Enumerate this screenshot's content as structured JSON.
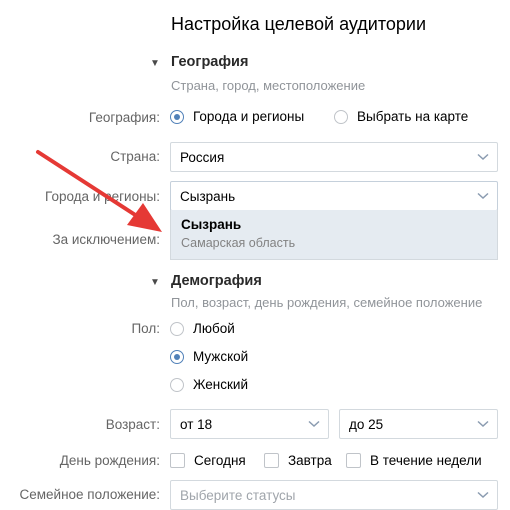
{
  "page_title": "Настройка целевой аудитории",
  "geography": {
    "title": "География",
    "subtitle": "Страна, город, местоположение",
    "label": "География:",
    "options": [
      "Города и регионы",
      "Выбрать на карте"
    ],
    "selected": "Города и регионы",
    "country_label": "Страна:",
    "country_value": "Россия",
    "cities_label": "Города и регионы:",
    "cities_value": "Сызрань",
    "except_label": "За исключением:",
    "suggestion": {
      "name": "Сызрань",
      "region": "Самарская область"
    }
  },
  "demography": {
    "title": "Демография",
    "subtitle": "Пол, возраст, день рождения, семейное положение",
    "gender_label": "Пол:",
    "gender_options": [
      "Любой",
      "Мужской",
      "Женский"
    ],
    "gender_selected": "Мужской",
    "age_label": "Возраст:",
    "age_from": "от 18",
    "age_to": "до 25",
    "birthday_label": "День рождения:",
    "birthday_options": [
      "Сегодня",
      "Завтра",
      "В течение недели"
    ],
    "family_label": "Семейное положение:",
    "family_placeholder": "Выберите статусы"
  },
  "colors": {
    "accent": "#5181b8",
    "arrow": "#e53935",
    "dropdown_bg": "#e5ebf1"
  },
  "icons": [
    "triangle-down-icon",
    "chevron-down-icon",
    "annotation-arrow"
  ]
}
